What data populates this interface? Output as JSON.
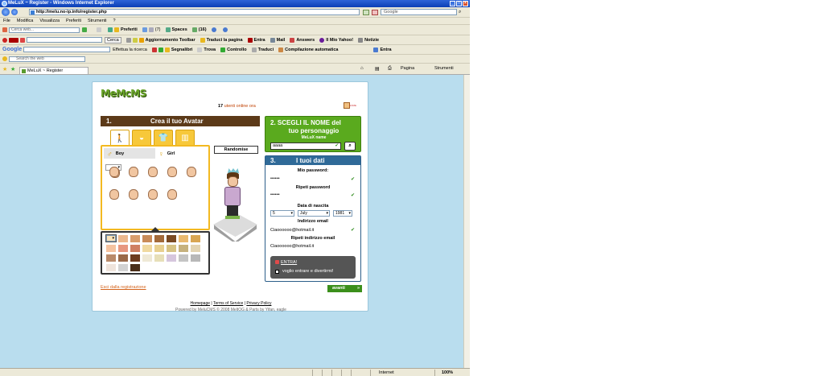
{
  "window": {
    "title": "MeLuX ~ Register - Windows Internet Explorer"
  },
  "address": {
    "url": "http://melu.no-ip.info/register.php",
    "search_placeholder": "Google"
  },
  "menu": [
    "File",
    "Modifica",
    "Visualizza",
    "Preferiti",
    "Strumenti",
    "?"
  ],
  "toolbar1": {
    "search_placeholder": "Cerca web...",
    "items": [
      "Preferiti",
      "(7)",
      "Spaces",
      "(16)"
    ]
  },
  "toolbar2": {
    "items": [
      "Cerca",
      "Aggiornamento Toolbar",
      "Traduci la pagina",
      "Entra",
      "Mail",
      "Answers",
      "Il Mio Yahoo!",
      "Notizie"
    ]
  },
  "toolbar3": {
    "items": [
      "Effettua la ricerca",
      "Segnalibri",
      "Trova",
      "Controllo",
      "Traduci",
      "Compilazione automatica",
      "Entra"
    ]
  },
  "toolbar4": {
    "search_placeholder": "Search the web"
  },
  "tab": {
    "label": "MeLuX ~ Register",
    "tools": [
      "Pagina",
      "Strumenti"
    ]
  },
  "status": {
    "zone": "Internet",
    "zoom": "100%"
  },
  "page": {
    "logo": "MeMcMS",
    "online_count": "17",
    "online_text": "utenti online ora",
    "home_label": "HOME",
    "section1": {
      "num": "1.",
      "title": "Crea il tuo Avatar"
    },
    "tabs_icons": [
      "person-icon",
      "hair-icon",
      "shirt-icon",
      "pants-icon"
    ],
    "gender": {
      "boy": "Boy",
      "girl": "Girl"
    },
    "randomise": "Randomise",
    "skin_colors": [
      "#f4c9a4",
      "#ecb88d",
      "#d89d6c",
      "#c98b58",
      "#a36a3a",
      "#7a4a23",
      "#fbe3b8",
      "#e9b96f",
      "#d9a653",
      "#f5c3a0",
      "#e79780",
      "#cf8063",
      "#f0d9a0",
      "#e8d090",
      "#d7c384",
      "#c6b17d",
      "#e3d4b2",
      "#b98a6a",
      "#9a6a4a",
      "#6d3b1f",
      "#efe9d6",
      "#e7dfb8",
      "#d6c6dd",
      "#c4c4c4",
      "#b8b8b8",
      "#efe4dc",
      "#d2d2d2",
      "#4a2e1a"
    ],
    "section2": {
      "title1": "2. SCEGLI IL NOME del",
      "title2": "tuo personaggio",
      "sub": "MeLuX name",
      "name_value": "aaaa"
    },
    "section3": {
      "num": "3.",
      "title": "I tuoi dati",
      "password_label": "Mio password:",
      "password_value": "••••••",
      "repeat_password_label": "Ripeti password",
      "repeat_password_value": "••••••",
      "dob_label": "Data di nascita",
      "dob_day": "5",
      "dob_month": "July",
      "dob_year": "1981",
      "email_label": "Indirizzo email",
      "email_value": "Ciaoooooo@hotmail.it",
      "repeat_email_label": "Ripeti indirizzo email",
      "repeat_email_value": "Ciaoooooo@hotmail.it",
      "entra_label": "ENTRA!",
      "checkbox_label": "voglio entrare e divertirmi!"
    },
    "exit_link": "Esci dalla registrazione",
    "next_button": "avanti",
    "footer": {
      "links": [
        "Homepage",
        "Terms of Service",
        "Privacy Policy"
      ],
      "powered": "Powered by MeluCMS © 2008 MeltOG & Parts by Yifan, eagle"
    }
  }
}
